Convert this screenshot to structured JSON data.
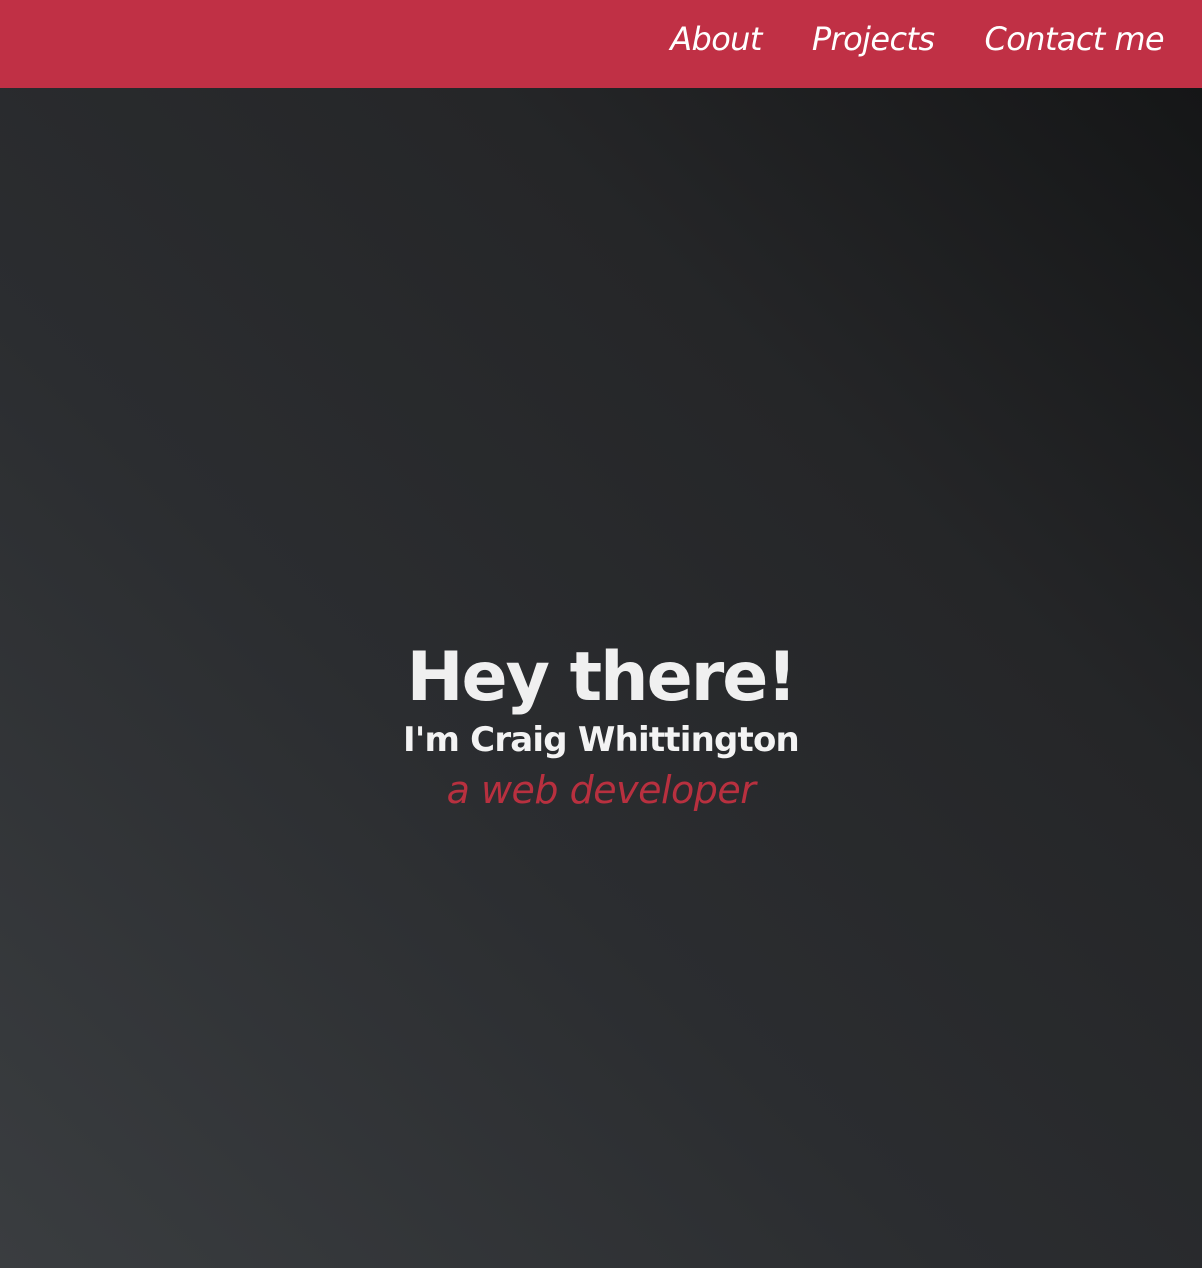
{
  "nav": {
    "items": [
      {
        "label": "About"
      },
      {
        "label": "Projects"
      },
      {
        "label": "Contact me"
      }
    ]
  },
  "hero": {
    "title": "Hey there!",
    "subtitle": "I'm Craig Whittington",
    "tagline": "a web developer"
  },
  "colors": {
    "accent": "#c03045",
    "tagline": "#b8303f",
    "background_dark": "#151617",
    "background_light": "#3a3d40",
    "text": "#f0f0f0"
  }
}
